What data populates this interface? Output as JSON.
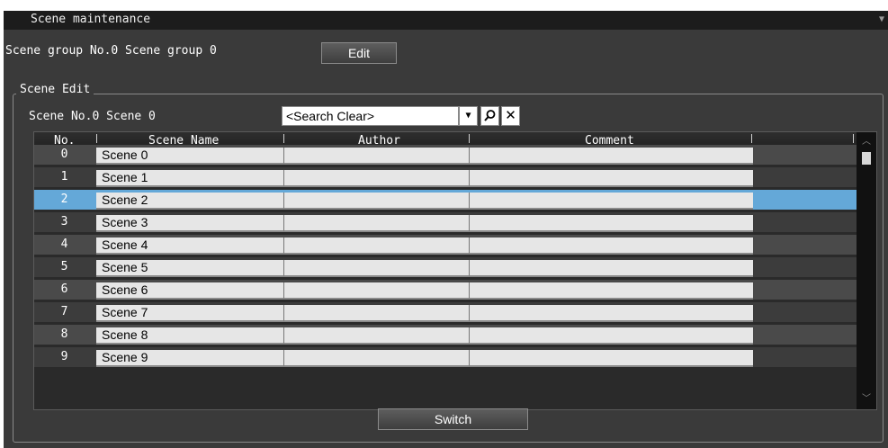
{
  "window": {
    "title": "Scene maintenance",
    "collapse_icon": "triangle-down-icon"
  },
  "scene_group": {
    "label": "Scene group No.0 Scene group 0",
    "edit_label": "Edit"
  },
  "scene_edit": {
    "legend": "Scene Edit",
    "current_scene": "Scene No.0 Scene 0",
    "search": {
      "value": "<Search Clear>",
      "dropdown_icon": "triangle-down-icon",
      "search_icon": "magnifier-icon",
      "clear_icon": "x-icon"
    }
  },
  "table": {
    "columns": [
      "No.",
      "Scene Name",
      "Author",
      "Comment"
    ],
    "selected_index": 2,
    "rows": [
      {
        "no": "0",
        "name": "Scene 0",
        "author": "",
        "comment": ""
      },
      {
        "no": "1",
        "name": "Scene 1",
        "author": "",
        "comment": ""
      },
      {
        "no": "2",
        "name": "Scene 2",
        "author": "",
        "comment": ""
      },
      {
        "no": "3",
        "name": "Scene 3",
        "author": "",
        "comment": ""
      },
      {
        "no": "4",
        "name": "Scene 4",
        "author": "",
        "comment": ""
      },
      {
        "no": "5",
        "name": "Scene 5",
        "author": "",
        "comment": ""
      },
      {
        "no": "6",
        "name": "Scene 6",
        "author": "",
        "comment": ""
      },
      {
        "no": "7",
        "name": "Scene 7",
        "author": "",
        "comment": ""
      },
      {
        "no": "8",
        "name": "Scene 8",
        "author": "",
        "comment": ""
      },
      {
        "no": "9",
        "name": "Scene 9",
        "author": "",
        "comment": ""
      }
    ]
  },
  "actions": {
    "switch_label": "Switch"
  },
  "colors": {
    "selected_row": "#64a8d8",
    "panel_bg": "#3a3a3a",
    "titlebar_bg": "#1c1c1c"
  }
}
